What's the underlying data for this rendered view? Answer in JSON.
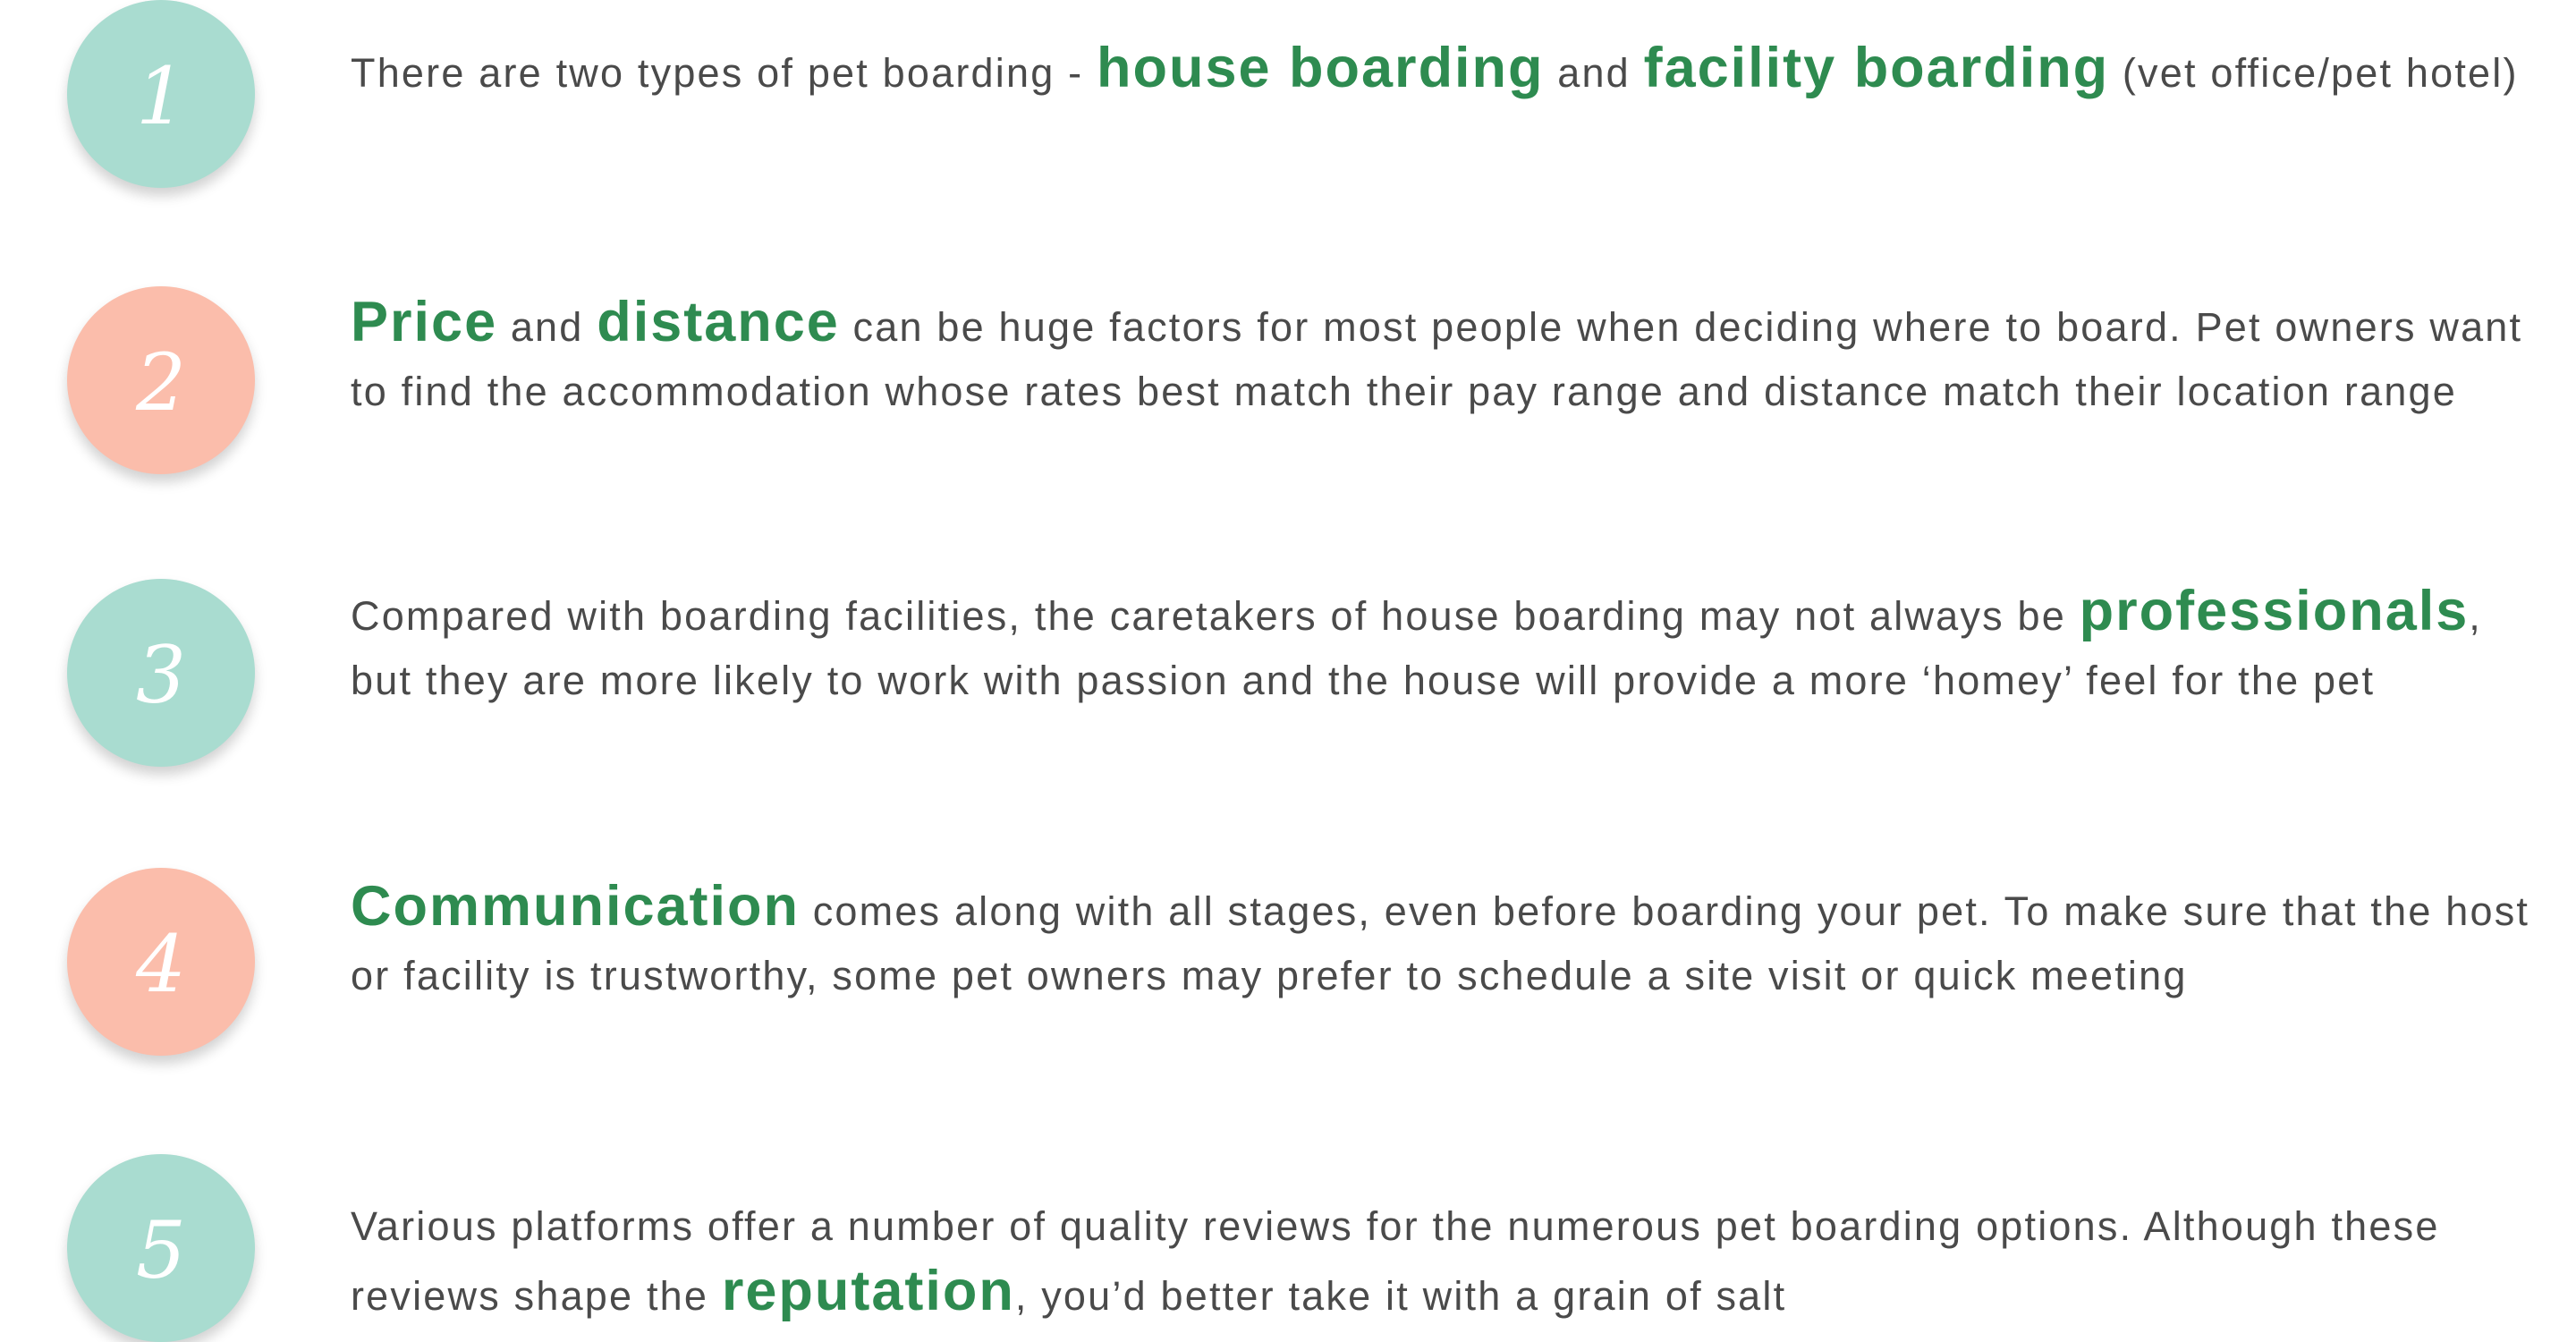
{
  "items": [
    {
      "number": "1",
      "color": "#a9dcd0",
      "parts": [
        "There are two types of pet boarding - ",
        "house boarding",
        " and ",
        "facility boarding",
        " (vet office/pet hotel)"
      ]
    },
    {
      "number": "2",
      "color": "#fbbdab",
      "parts": [
        "Price",
        " and ",
        "distance",
        " can be huge factors for most people when deciding where to board. Pet owners want to find the accommodation whose rates best match their pay range and distance match their location range"
      ]
    },
    {
      "number": "3",
      "color": "#a9dcd0",
      "parts": [
        "Compared with boarding facilities, the caretakers of house boarding may not always be ",
        "professionals",
        ", but they are more likely to work with passion and the house will provide a more ‘homey’ feel for the pet"
      ]
    },
    {
      "number": "4",
      "color": "#fbbdab",
      "parts": [
        "Communication",
        " comes along with all stages, even before boarding your pet. To make sure that the host or facility is trustworthy, some pet owners may prefer to schedule a site visit or quick meeting"
      ]
    },
    {
      "number": "5",
      "color": "#a9dcd0",
      "parts": [
        "Various platforms offer a number of quality reviews for the numerous pet boarding options. Although these reviews shape the ",
        "reputation",
        ", you’d better take it with a grain of salt"
      ]
    }
  ],
  "highlight_color": "#2e8b50",
  "text_color": "#4a4a4a"
}
